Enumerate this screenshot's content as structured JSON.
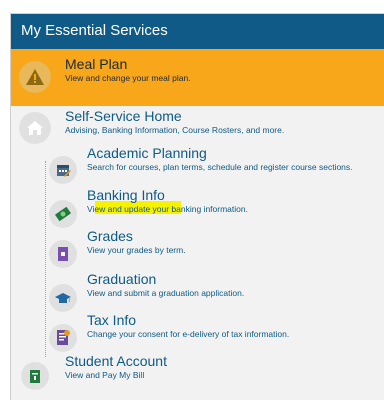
{
  "header": {
    "title": "My Essential Services"
  },
  "services": {
    "meal_plan": {
      "title": "Meal Plan",
      "desc": "View and change your meal plan."
    },
    "self_service_home": {
      "title": "Self-Service Home",
      "desc": "Advising, Banking Information, Course Rosters, and more."
    },
    "academic_planning": {
      "title": "Academic Planning",
      "desc": "Search for courses, plan terms, schedule and register course sections."
    },
    "banking_info": {
      "title": "Banking Info",
      "desc": "View and update your banking information."
    },
    "grades": {
      "title": "Grades",
      "desc": "View your grades by term."
    },
    "graduation": {
      "title": "Graduation",
      "desc": "View and submit a graduation application."
    },
    "tax_info": {
      "title": "Tax Info",
      "desc": "Change your consent for e-delivery of tax information."
    },
    "student_account": {
      "title": "Student Account",
      "desc": "View and Pay My Bill"
    }
  },
  "icons": {
    "meal_plan": "warning-icon",
    "self_service_home": "home-icon",
    "academic_planning": "calendar-icon",
    "banking_info": "money-icon",
    "grades": "grades-icon",
    "graduation": "graduation-cap-icon",
    "tax_info": "tax-document-icon",
    "student_account": "account-icon"
  },
  "colors": {
    "header_bg": "#0f5a86",
    "warning_bg": "#f8a61a",
    "link_text": "#0f5a86",
    "highlight": "#f6f200"
  }
}
